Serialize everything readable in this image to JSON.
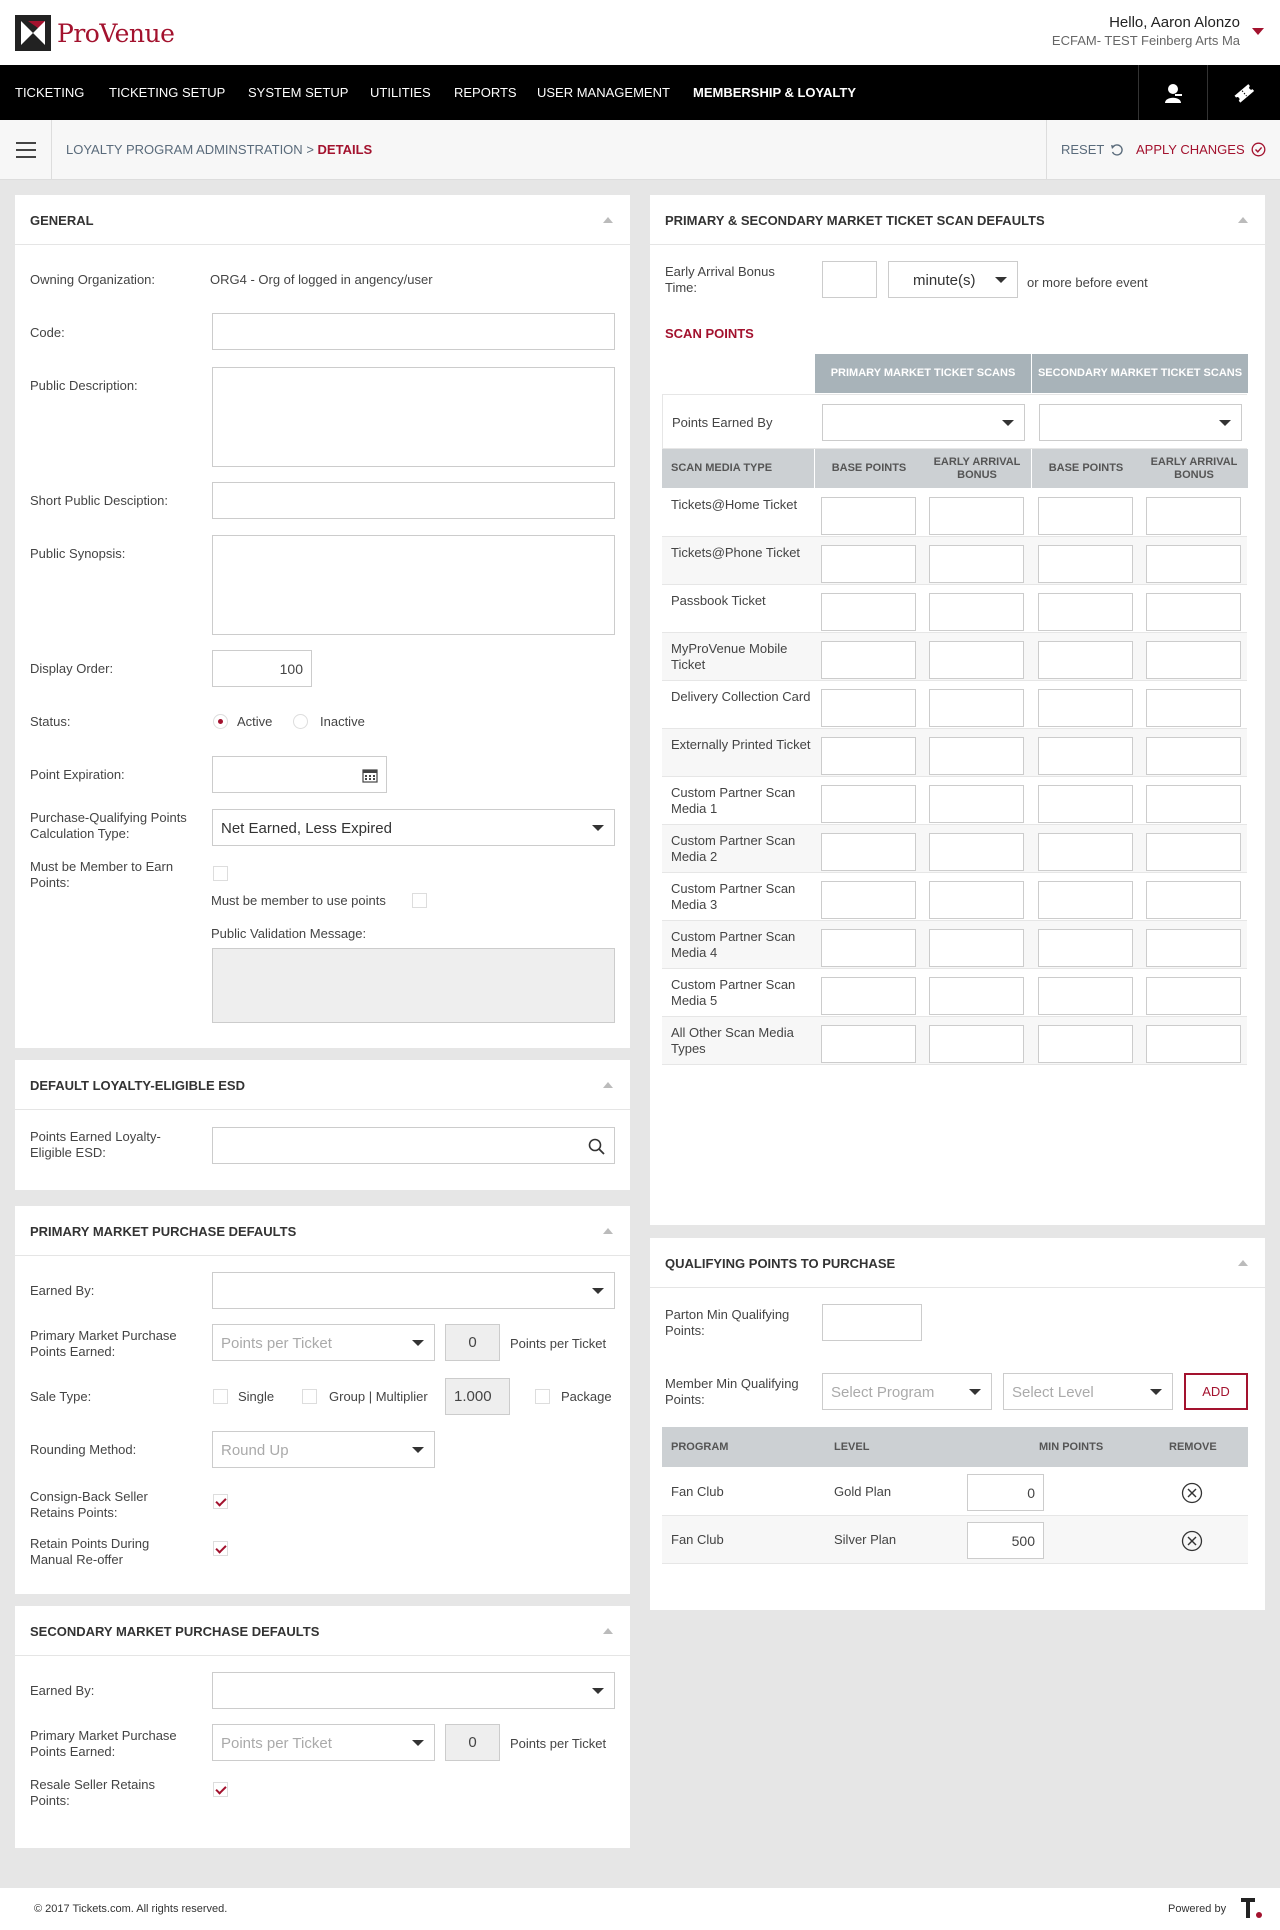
{
  "header": {
    "brand": "ProVenue",
    "greeting": "Hello, Aaron Alonzo",
    "organization": "ECFAM- TEST Feinberg Arts Ma"
  },
  "nav": {
    "items": [
      "TICKETING",
      "TICKETING SETUP",
      "SYSTEM SETUP",
      "UTILITIES",
      "REPORTS",
      "USER MANAGEMENT",
      "MEMBERSHIP & LOYALTY"
    ],
    "icons": [
      "user-admin-icon",
      "ticket-tag-icon"
    ]
  },
  "breadcrumb": {
    "parent": "LOYALTY PROGRAM ADMINSTRATION",
    "separator": ">",
    "current": "DETAILS"
  },
  "actions": {
    "reset": "RESET",
    "apply": "APPLY CHANGES"
  },
  "general": {
    "title": "GENERAL",
    "owning_org_label": "Owning Organization:",
    "owning_org_value": "ORG4 - Org of logged in angency/user",
    "code_label": "Code:",
    "public_desc_label": "Public Description:",
    "short_desc_label": "Short Public Desciption:",
    "synopsis_label": "Public Synopsis:",
    "display_order_label": "Display Order:",
    "display_order_value": "100",
    "status_label": "Status:",
    "status_active": "Active",
    "status_inactive": "Inactive",
    "point_exp_label": "Point Expiration:",
    "calc_type_label": "Purchase-Qualifying Points Calculation Type:",
    "calc_type_value": "Net Earned, Less Expired",
    "must_member_earn_label": "Must be Member to Earn Points:",
    "must_member_use_label": "Must be member to use points",
    "validation_msg_label": "Public Validation Message:"
  },
  "esd": {
    "title": "DEFAULT LOYALTY-ELIGIBLE ESD",
    "label": "Points Earned Loyalty-Eligible ESD:"
  },
  "primary": {
    "title": "PRIMARY MARKET PURCHASE DEFAULTS",
    "earned_by_label": "Earned By:",
    "points_earned_label": "Primary Market Purchase Points Earned:",
    "points_placeholder": "Points per Ticket",
    "points_value": "0",
    "points_suffix": "Points per Ticket",
    "sale_type_label": "Sale Type:",
    "single": "Single",
    "group": "Group | Multiplier",
    "multiplier_value": "1.000",
    "package": "Package",
    "rounding_label": "Rounding Method:",
    "rounding_placeholder": "Round Up",
    "consign_label": "Consign-Back Seller Retains Points:",
    "retain_label": "Retain Points During Manual Re-offer"
  },
  "secondary": {
    "title": "SECONDARY MARKET PURCHASE DEFAULTS",
    "earned_by_label": "Earned By:",
    "points_earned_label": "Primary Market Purchase Points Earned:",
    "points_placeholder": "Points per Ticket",
    "points_value": "0",
    "points_suffix": "Points per Ticket",
    "resale_label": "Resale Seller Retains Points:"
  },
  "scan": {
    "title": "PRIMARY & SECONDARY MARKET TICKET SCAN DEFAULTS",
    "early_label": "Early Arrival Bonus Time:",
    "unit_value": "minute(s)",
    "early_suffix": "or more before event",
    "scan_points_title": "SCAN POINTS",
    "primary_header": "PRIMARY MARKET TICKET SCANS",
    "secondary_header": "SECONDARY MARKET TICKET SCANS",
    "points_earned_by": "Points Earned By",
    "col_media": "SCAN MEDIA TYPE",
    "col_base": "BASE POINTS",
    "col_early": "EARLY ARRIVAL BONUS",
    "media_types": [
      "Tickets@Home Ticket",
      "Tickets@Phone Ticket",
      "Passbook Ticket",
      "MyProVenue Mobile Ticket",
      "Delivery Collection Card",
      "Externally Printed Ticket",
      "Custom Partner Scan Media 1",
      "Custom Partner Scan Media 2",
      "Custom Partner Scan Media 3",
      "Custom Partner Scan Media 4",
      "Custom Partner Scan Media 5",
      "All Other Scan Media Types"
    ]
  },
  "qualifying": {
    "title": "QUALIFYING POINTS TO PURCHASE",
    "patron_label": "Parton Min Qualifying Points:",
    "member_label": "Member Min Qualifying Points:",
    "program_placeholder": "Select Program",
    "level_placeholder": "Select Level",
    "add": "ADD",
    "col_program": "PROGRAM",
    "col_level": "LEVEL",
    "col_min": "MIN POINTS",
    "col_remove": "REMOVE",
    "rows": [
      {
        "program": "Fan Club",
        "level": "Gold Plan",
        "min": "0"
      },
      {
        "program": "Fan Club",
        "level": "Silver Plan",
        "min": "500"
      }
    ]
  },
  "footer": {
    "copyright": "© 2017 Tickets.com. All rights reserved.",
    "powered": "Powered by"
  },
  "colors": {
    "accent": "#a3122e",
    "nav_bg": "#000000",
    "page_bg": "#e6e6e6"
  }
}
